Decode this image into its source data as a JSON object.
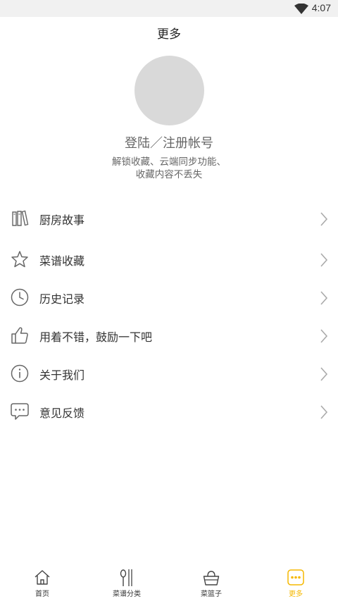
{
  "status_bar": {
    "time": "4:07",
    "wifi_icon": "wifi-icon"
  },
  "header": {
    "title": "更多"
  },
  "profile": {
    "avatar_icon": "avatar-placeholder",
    "login_label": "登陆／注册帐号",
    "description_line1": "解锁收藏、云端同步功能、",
    "description_line2": "收藏内容不丢失"
  },
  "menu": {
    "items": [
      {
        "label": "厨房故事",
        "icon": "book-icon"
      },
      {
        "label": "菜谱收藏",
        "icon": "star-icon"
      },
      {
        "label": "历史记录",
        "icon": "clock-icon"
      },
      {
        "label": "用着不错，鼓励一下吧",
        "icon": "thumbs-up-icon"
      },
      {
        "label": "关于我们",
        "icon": "info-icon"
      },
      {
        "label": "意见反馈",
        "icon": "chat-bubble-icon"
      }
    ],
    "arrow_icon": "chevron-right-icon"
  },
  "tabbar": {
    "tabs": [
      {
        "label": "首页",
        "icon": "home-icon",
        "active": false
      },
      {
        "label": "菜谱分类",
        "icon": "spoon-chopsticks-icon",
        "active": false
      },
      {
        "label": "菜篮子",
        "icon": "basket-icon",
        "active": false
      },
      {
        "label": "更多",
        "icon": "more-dots-icon",
        "active": true
      }
    ]
  },
  "colors": {
    "accent": "#f5b800",
    "text_primary": "#333333",
    "text_secondary": "#666666",
    "avatar_placeholder": "#d9d9d9",
    "status_bar_bg": "#f1f1f1"
  }
}
